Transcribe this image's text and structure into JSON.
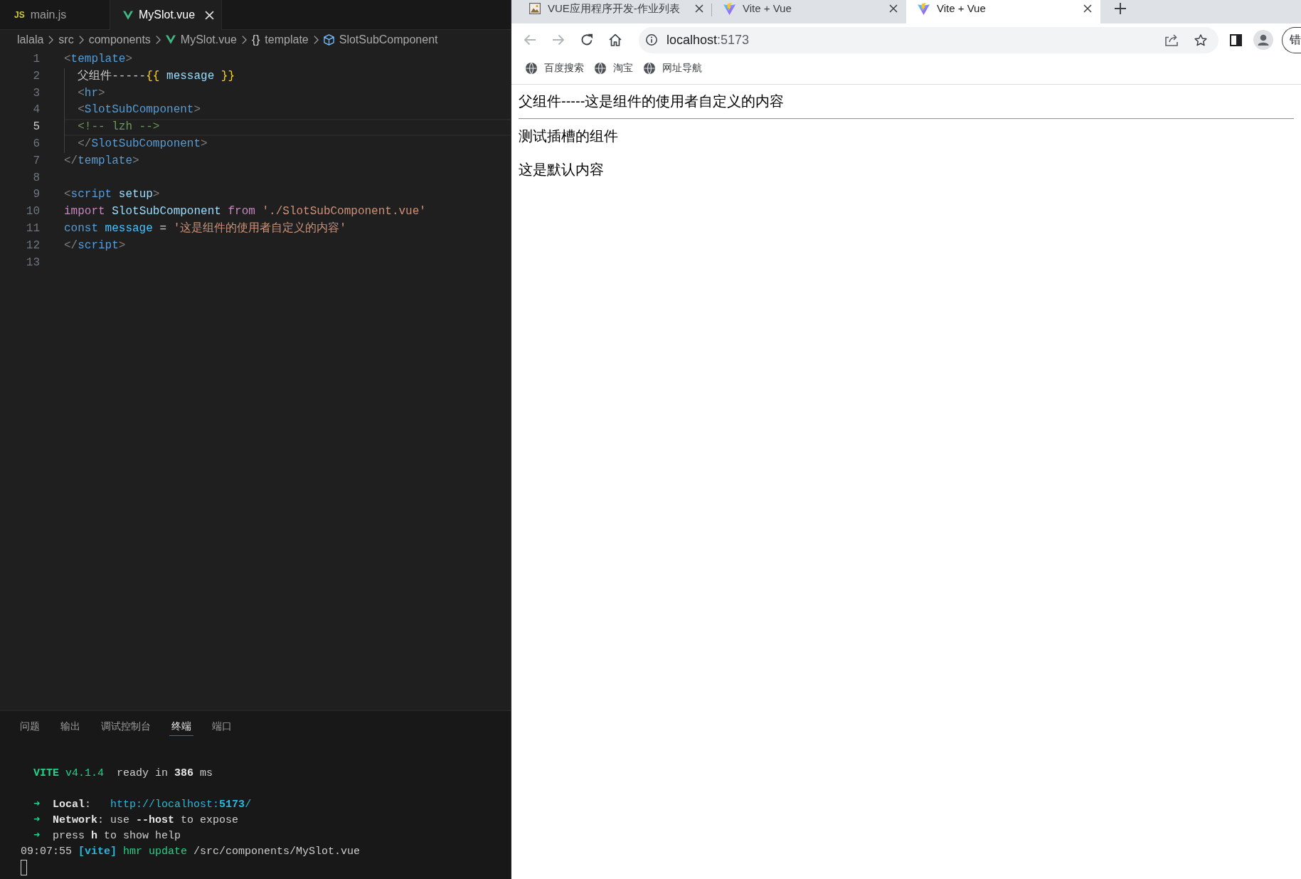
{
  "editor": {
    "tabs": [
      {
        "label": "main.js",
        "icon": {
          "kind": "text",
          "text": "JS"
        },
        "selected": false
      },
      {
        "label": "MySlot.vue",
        "icon": {
          "kind": "vue"
        },
        "selected": true
      }
    ],
    "breadcrumb": [
      {
        "label": "lalala"
      },
      {
        "label": "src"
      },
      {
        "label": "components"
      },
      {
        "label": "MySlot.vue",
        "icon": {
          "kind": "vue"
        }
      },
      {
        "label": "template",
        "icon": {
          "kind": "text",
          "text": "{}"
        }
      },
      {
        "label": "SlotSubComponent",
        "icon": {
          "kind": "cube"
        }
      }
    ],
    "lines": [
      {
        "number": "1",
        "current": false,
        "tokens": [
          {
            "kind": "punct",
            "text": "<"
          },
          {
            "kind": "tag",
            "text": "template"
          },
          {
            "kind": "punct",
            "text": ">"
          }
        ],
        "children": [
          {
            "number": "2",
            "current": false,
            "tokens": [
              {
                "kind": "text",
                "text": "父组件-----"
              },
              {
                "kind": "brace",
                "text": "{{ "
              },
              {
                "kind": "var",
                "text": "message"
              },
              {
                "kind": "brace",
                "text": " }}"
              }
            ]
          },
          {
            "number": "3",
            "current": false,
            "tokens": [
              {
                "kind": "punct",
                "text": "<"
              },
              {
                "kind": "tag",
                "text": "hr"
              },
              {
                "kind": "punct",
                "text": ">"
              }
            ]
          },
          {
            "number": "4",
            "current": false,
            "tokens": [
              {
                "kind": "punct",
                "text": "<"
              },
              {
                "kind": "tag",
                "text": "SlotSubComponent"
              },
              {
                "kind": "punct",
                "text": ">"
              }
            ]
          },
          {
            "number": "5",
            "current": true,
            "tokens": [
              {
                "kind": "comment",
                "text": "<!-- lzh -->"
              }
            ]
          },
          {
            "number": "6",
            "current": false,
            "tokens": [
              {
                "kind": "punct",
                "text": "</"
              },
              {
                "kind": "tag",
                "text": "SlotSubComponent"
              },
              {
                "kind": "punct",
                "text": ">"
              }
            ]
          }
        ]
      },
      {
        "number": "7",
        "current": false,
        "tokens": [
          {
            "kind": "punct",
            "text": "</"
          },
          {
            "kind": "tag",
            "text": "template"
          },
          {
            "kind": "punct",
            "text": ">"
          }
        ]
      },
      {
        "number": "8",
        "current": false
      },
      {
        "number": "9",
        "current": false,
        "tokens": [
          {
            "kind": "punct",
            "text": "<"
          },
          {
            "kind": "tag",
            "text": "script"
          },
          {
            "kind": "attr",
            "text": " setup"
          },
          {
            "kind": "punct",
            "text": ">"
          }
        ]
      },
      {
        "number": "10",
        "current": false,
        "tokens": [
          {
            "kind": "keyword",
            "text": "import "
          },
          {
            "kind": "var",
            "text": "SlotSubComponent "
          },
          {
            "kind": "keyword",
            "text": "from "
          },
          {
            "kind": "string",
            "text": "'./SlotSubComponent.vue'"
          }
        ]
      },
      {
        "number": "11",
        "current": false,
        "tokens": [
          {
            "kind": "storage",
            "text": "const "
          },
          {
            "kind": "constant",
            "text": "message"
          },
          {
            "kind": "text",
            "text": " = "
          },
          {
            "kind": "string",
            "text": "'这是组件的使用者自定义的内容'"
          }
        ]
      },
      {
        "number": "12",
        "current": false,
        "tokens": [
          {
            "kind": "punct",
            "text": "</"
          },
          {
            "kind": "tag",
            "text": "script"
          },
          {
            "kind": "punct",
            "text": ">"
          }
        ]
      },
      {
        "number": "13",
        "current": false
      }
    ]
  },
  "panel": {
    "tabs": [
      {
        "label": "问题",
        "selected": false
      },
      {
        "label": "输出",
        "selected": false
      },
      {
        "label": "调试控制台",
        "selected": false
      },
      {
        "label": "终端",
        "selected": true
      },
      {
        "label": "端口",
        "selected": false
      }
    ],
    "terminal": {
      "blocks": [
        {
          "lines": [
            {
              "kind": "indented",
              "tokens": [
                {
                  "kind": "green-bold",
                  "text": "VITE"
                },
                {
                  "kind": "green",
                  "text": " v4.1.4"
                },
                {
                  "kind": "plain",
                  "text": "  ready in "
                },
                {
                  "kind": "bold",
                  "text": "386"
                },
                {
                  "kind": "plain",
                  "text": " ms"
                }
              ]
            }
          ]
        },
        {
          "lines": [
            {
              "kind": "indented",
              "tokens": [
                {
                  "kind": "green",
                  "text": "➜  "
                },
                {
                  "kind": "bold",
                  "text": "Local"
                },
                {
                  "kind": "plain",
                  "text": ":   "
                },
                {
                  "kind": "cyan",
                  "text": "http://localhost:"
                },
                {
                  "kind": "cyan-bold",
                  "text": "5173"
                },
                {
                  "kind": "cyan",
                  "text": "/"
                }
              ]
            },
            {
              "kind": "indented",
              "tokens": [
                {
                  "kind": "green",
                  "text": "➜  "
                },
                {
                  "kind": "bold",
                  "text": "Network"
                },
                {
                  "kind": "plain",
                  "text": ": use "
                },
                {
                  "kind": "bold",
                  "text": "--host"
                },
                {
                  "kind": "plain",
                  "text": " to expose"
                }
              ]
            },
            {
              "kind": "indented",
              "tokens": [
                {
                  "kind": "green",
                  "text": "➜  "
                },
                {
                  "kind": "plain",
                  "text": "press "
                },
                {
                  "kind": "bold",
                  "text": "h"
                },
                {
                  "kind": "plain",
                  "text": " to show help"
                }
              ]
            },
            {
              "kind": "flush",
              "tokens": [
                {
                  "kind": "plain",
                  "text": "09:07:55 "
                },
                {
                  "kind": "cyan-bold",
                  "text": "[vite]"
                },
                {
                  "kind": "green",
                  "text": " hmr update"
                },
                {
                  "kind": "plain",
                  "text": " /src/components/MySlot.vue"
                }
              ]
            }
          ]
        }
      ],
      "cursor": true
    }
  },
  "browser": {
    "tabs": [
      {
        "title": "VUE应用程序开发-作业列表",
        "kind": "picture",
        "selected": false
      },
      {
        "title": "Vite + Vue",
        "kind": "bolt",
        "selected": false
      },
      {
        "title": "Vite + Vue",
        "kind": "bolt",
        "selected": true
      }
    ],
    "address": {
      "host": "localhost",
      "port": ":5173"
    },
    "toolbar_button": {
      "label": "错"
    },
    "bookmarks": [
      {
        "label": "百度搜索"
      },
      {
        "label": "淘宝"
      },
      {
        "label": "网址导航"
      }
    ],
    "page": [
      {
        "kind": "text",
        "text": "父组件-----这是组件的使用者自定义的内容"
      },
      {
        "kind": "rule"
      },
      {
        "kind": "text",
        "text": "测试插槽的组件"
      },
      {
        "kind": "paragraph",
        "text": "这是默认内容"
      }
    ]
  }
}
